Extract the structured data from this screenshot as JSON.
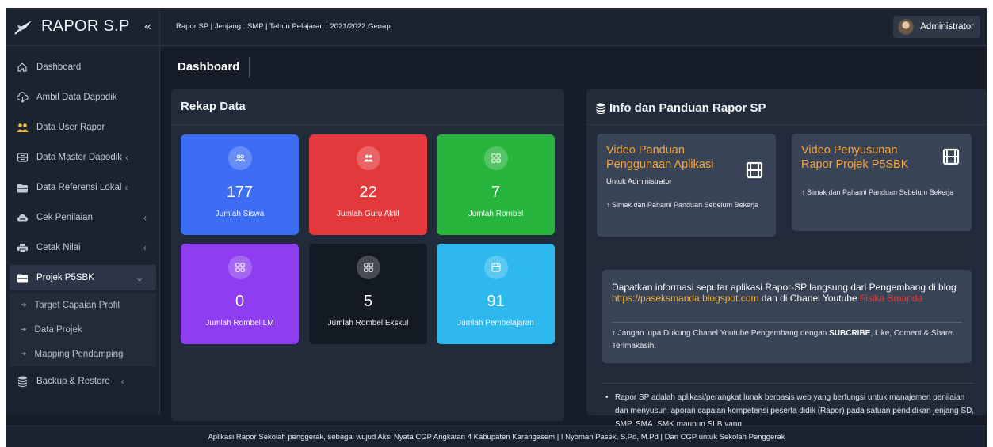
{
  "app": {
    "title": "RAPOR S.P",
    "collapse_glyph": "«"
  },
  "topbar": {
    "info": "Rapor SP | Jenjang : SMP | Tahun Pelajaran : 2021/2022 Genap",
    "user": "Administrator"
  },
  "sidebar": {
    "items": [
      {
        "label": "Dashboard",
        "icon": "home-icon"
      },
      {
        "label": "Ambil Data Dapodik",
        "icon": "download-icon"
      },
      {
        "label": "Data User Rapor",
        "icon": "users-icon"
      },
      {
        "label": "Data Master Dapodik",
        "icon": "layers-icon",
        "chevron": "‹"
      },
      {
        "label": "Data Referensi Lokal",
        "icon": "folder-icon",
        "chevron": "‹"
      },
      {
        "label": "Cek Penilaian",
        "icon": "cloud-icon",
        "chevron": "‹"
      },
      {
        "label": "Cetak Nilai",
        "icon": "printer-icon",
        "chevron": "‹"
      },
      {
        "label": "Projek P5SBK",
        "icon": "folder-open-icon",
        "chevron": "⌄"
      },
      {
        "label": "Backup & Restore",
        "icon": "database-icon",
        "chevron": "‹"
      }
    ],
    "subitems": [
      {
        "label": "Target Capaian Profil"
      },
      {
        "label": "Data Projek"
      },
      {
        "label": "Mapping Pendamping"
      }
    ]
  },
  "page": {
    "title": "Dashboard"
  },
  "rekap": {
    "title": "Rekap Data",
    "stats": [
      {
        "value": "177",
        "label": "Jumlah Siswa",
        "color": "#3e6df5",
        "icon": "users-icon"
      },
      {
        "value": "22",
        "label": "Jumlah Guru Aktif",
        "color": "#e4393c",
        "icon": "teacher-icon"
      },
      {
        "value": "7",
        "label": "Jumlah Rombel",
        "color": "#27b43c",
        "icon": "grid-icon"
      },
      {
        "value": "0",
        "label": "Jumlah Rombel LM",
        "color": "#8e3df0",
        "icon": "grid-icon"
      },
      {
        "value": "5",
        "label": "Jumlah Rombel Ekskul",
        "color": "#141a24",
        "icon": "grid-icon"
      },
      {
        "value": "91",
        "label": "Jumlah Pembelajaran",
        "color": "#2eb9ee",
        "icon": "calendar-icon"
      }
    ]
  },
  "info": {
    "title": "Info dan Panduan Rapor SP",
    "videos": [
      {
        "title_line1": "Video Panduan",
        "title_line2": "Penggunaan Aplikasi",
        "subtitle": "Untuk Administrator",
        "note": "↑ Simak dan Pahami Panduan Sebelum Bekerja"
      },
      {
        "title_line1": "Video Penyusunan",
        "title_line2": "Rapor Projek P5SBK",
        "subtitle": "",
        "note": "↑ Simak dan Pahami Panduan Sebelum Bekerja"
      }
    ],
    "blog": {
      "text1": "Dapatkan informasi seputar aplikasi Rapor-SP langsung dari Pengembang di blog ",
      "link": "https://paseksmanda.blogspot.com",
      "text2": " dan di Chanel Youtube ",
      "channel": "Fisika Smanda",
      "note_pre": "↑ Jangan lupa Dukung Chanel Youtube Pengembang dengan ",
      "note_bold": "SUBCRIBE",
      "note_post": ", Like, Coment & Share. Terimakasih."
    },
    "bullet": "Rapor SP adalah aplikasi/perangkat lunak berbasis web yang berfungsi untuk manajemen penilaian dan menyusun laporan capaian kompetensi peserta didik (Rapor) pada satuan pendidikan jenjang SD, SMP, SMA, SMK maupun SLB yang"
  },
  "footer": "Aplikasi Rapor Sekolah penggerak, sebagai wujud Aksi Nyata CGP Angkatan 4 Kabupaten Karangasem | I Nyoman Pasek, S.Pd, M.Pd | Dari CGP untuk Sekolah Penggerak"
}
